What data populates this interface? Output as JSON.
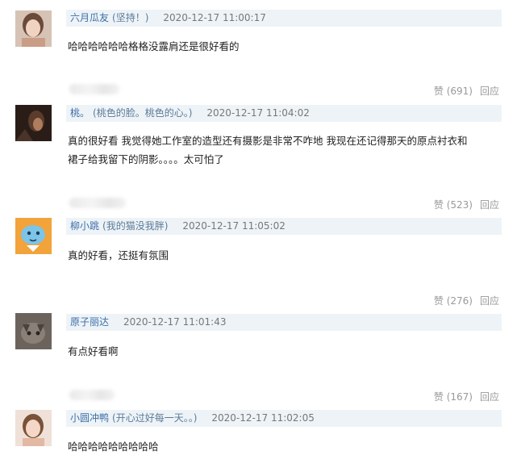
{
  "comments": [
    {
      "user": "六月瓜友",
      "signature": "(坚持！)",
      "time": "2020-12-17 11:00:17",
      "text": "哈哈哈哈哈哈格格没露肩还是很好看的",
      "likes": "赞 (691)",
      "reply": "回应",
      "avatar_color": "#d9b8a6"
    },
    {
      "user": "桃。",
      "signature": "(桃色的脸。桃色的心。)",
      "time": "2020-12-17 11:04:02",
      "text_lines": [
        "真的很好看 我觉得她工作室的造型还有摄影是非常不咋地 我现在还记得那天的原点衬衣和",
        "裙子给我留下的阴影。。。。太可怕了"
      ],
      "likes": "赞 (523)",
      "reply": "回应",
      "avatar_color": "#3a2a22"
    },
    {
      "user": "柳小跳",
      "signature": "(我的猫没我胖)",
      "time": "2020-12-17 11:05:02",
      "text": "真的好看，还挺有氛围",
      "likes": "赞 (276)",
      "reply": "回应",
      "avatar_color": "#f2a33a"
    },
    {
      "user": "原子丽达",
      "signature": "",
      "time": "2020-12-17 11:01:43",
      "text": "有点好看啊",
      "likes": "赞 (167)",
      "reply": "回应",
      "avatar_color": "#5b544e"
    },
    {
      "user": "小圆冲鸭",
      "signature": "(开心过好每一天。。)",
      "time": "2020-12-17 11:02:05",
      "text": "哈哈哈哈哈哈哈哈哈",
      "avatar_color": "#e8c6b2"
    }
  ]
}
